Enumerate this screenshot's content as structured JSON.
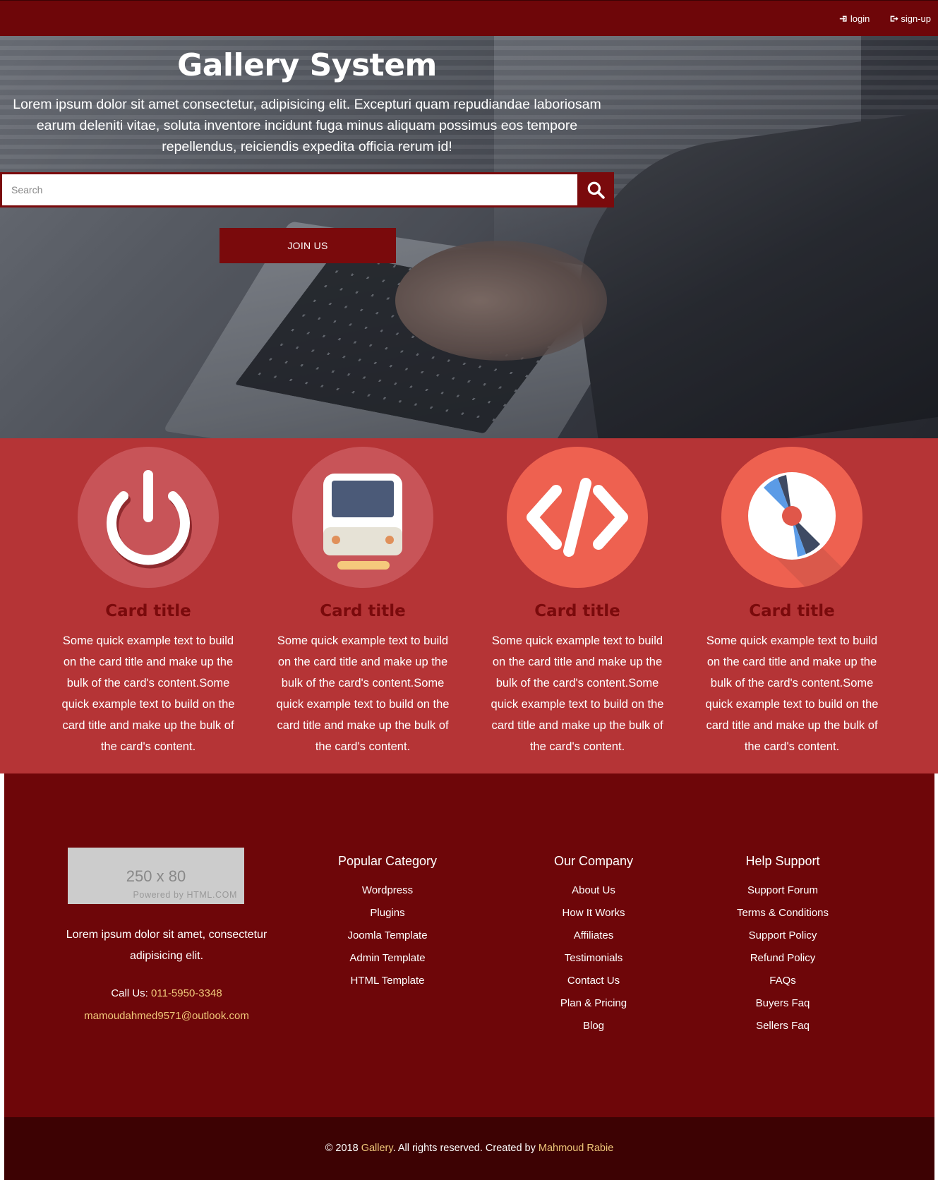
{
  "nav": {
    "login_label": "login",
    "signup_label": "sign-up"
  },
  "hero": {
    "title": "Gallery System",
    "text": "Lorem ipsum dolor sit amet consectetur, adipisicing elit. Excepturi quam repudiandae laboriosam earum deleniti vitae, soluta inventore incidunt fuga minus aliquam possimus eos tempore repellendus, reiciendis expedita officia rerum id!",
    "search_placeholder": "Search",
    "join_label": "JOIN US"
  },
  "cards": [
    {
      "icon": "power-icon",
      "title": "Card title",
      "text": "Some quick example text to build on the card title and make up the bulk of the card's content.Some quick example text to build on the card title and make up the bulk of the card's content."
    },
    {
      "icon": "train-icon",
      "title": "Card title",
      "text": "Some quick example text to build on the card title and make up the bulk of the card's content.Some quick example text to build on the card title and make up the bulk of the card's content."
    },
    {
      "icon": "code-icon",
      "title": "Card title",
      "text": "Some quick example text to build on the card title and make up the bulk of the card's content.Some quick example text to build on the card title and make up the bulk of the card's content."
    },
    {
      "icon": "disc-icon",
      "title": "Card title",
      "text": "Some quick example text to build on the card title and make up the bulk of the card's content.Some quick example text to build on the card title and make up the bulk of the card's content."
    }
  ],
  "footer": {
    "logo_big": "250 x 80",
    "logo_small": "Powered by HTML.COM",
    "about": "Lorem ipsum dolor sit amet, consectetur adipisicing elit.",
    "call_label": "Call Us:",
    "phone": "011-5950-3348",
    "email": "mamoudahmed9571@outlook.com",
    "columns": [
      {
        "title": "Popular Category",
        "items": [
          "Wordpress",
          "Plugins",
          "Joomla Template",
          "Admin Template",
          "HTML Template"
        ]
      },
      {
        "title": "Our Company",
        "items": [
          "About Us",
          "How It Works",
          "Affiliates",
          "Testimonials",
          "Contact Us",
          "Plan & Pricing",
          "Blog"
        ]
      },
      {
        "title": "Help Support",
        "items": [
          "Support Forum",
          "Terms & Conditions",
          "Support Policy",
          "Refund Policy",
          "FAQs",
          "Buyers Faq",
          "Sellers Faq"
        ]
      }
    ]
  },
  "copyright": {
    "prefix": "© 2018",
    "brand": "Gallery",
    "middle": ". All rights reserved. Created by",
    "author": "Mahmoud Rabie"
  },
  "colors": {
    "nav_bg": "#6e0609",
    "card_section_bg": "#b53436",
    "footer_bg": "#6e0609",
    "copyright_bg": "#3d0203",
    "accent_link": "#f0c87a"
  }
}
